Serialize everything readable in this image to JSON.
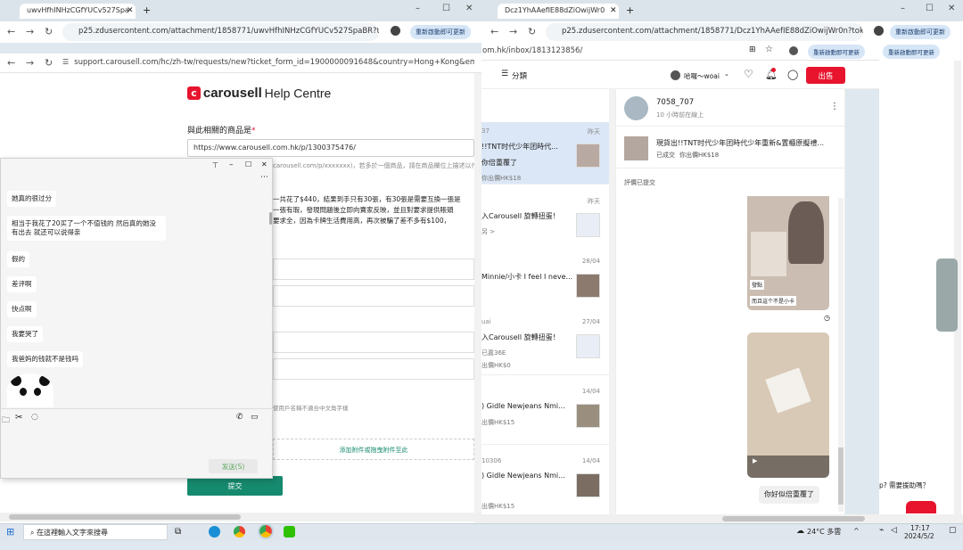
{
  "left_browser": {
    "tab_title": "uwvHfhINHzCGfYUCv527Spa",
    "url1": "p25.zdusercontent.com/attachment/1858771/uwvHfhINHzCGfYUCv527SpaBR?token...",
    "url2": "support.carousell.com/hc/zh-tw/requests/new?ticket_form_id=1900000091648&country=Hong+Kong&email=cixuan0",
    "update_pill": "重新啟動即可更新"
  },
  "help_page": {
    "logo_text": "carousell",
    "help_centre": "Help Centre",
    "item_label": "與此相關的商品是",
    "required_mark": "*",
    "item_url": "https://www.carousell.com.hk/p/1300375476/",
    "partial_hint": "carousell.com/p/xxxxxxx)，若多於一個商品，請在商品欄位上描述以作分辨",
    "desc_line1": "一共花了$440，結果到手只有30張，有30張是需要互換一張是",
    "desc_line2": "一張有瑕，發現問題後立即向賣家反映，並且對要求提供賬頭",
    "desc_line3": "要求全，因為卡牌生活費用高，再次被騙了差不多有$100，",
    "filename_hint": "使用戶名稱不適合中文角字樣",
    "attach_link": "添加附件或拖曳附件至此",
    "submit": "提交"
  },
  "chat_popup": {
    "messages": [
      "她真的很过分",
      "相当于我花了20买了一个不值钱的 然后真的她没有出去 就还可以说得亲",
      "假的",
      "差评啊",
      "快点啊",
      "我要哭了",
      "我爸妈的钱就不是钱吗"
    ],
    "send_button": "发送(S)"
  },
  "right_browser": {
    "tab_title": "Dcz1YhAAefIE88dZiOwijWr0",
    "url1": "p25.zdusercontent.com/attachment/1858771/Dcz1YhAAefIE88dZiOwijWr0n?token=...",
    "url2": "om.hk/inbox/1813123856/",
    "update_pill": "重新啟動即可更新",
    "category": "分類",
    "user_name": "哈囉～woai",
    "sell_button": "出售"
  },
  "conversations": [
    {
      "date": "昨天",
      "title": "!!TNT时代少年团時代...",
      "sub": "你倍重覆了",
      "sub2": "你出價HK$18"
    },
    {
      "date": "昨天",
      "title": "入Carousell 旋轉扭蛋！",
      "sub": "另 >",
      "sub2": ""
    },
    {
      "date": "28/04",
      "title": "Minnie/小卡 I feel I neve...",
      "sub": "",
      "sub2": ""
    },
    {
      "date": "27/04",
      "title": "入Carousell 旋轉扭蛋！",
      "sub": "已嘉36E",
      "sub2": "出價HK$0"
    },
    {
      "date": "14/04",
      "title": ") Gidle Newjeans Nmi...",
      "sub": "出價HK$15",
      "sub2": ""
    },
    {
      "date": "14/04",
      "title": ") Gidle Newjeans Nmi...",
      "sub": "出價HK$15",
      "sub2": ""
    }
  ],
  "chat_detail": {
    "seller": "7058_707",
    "status": "10 小時前在線上",
    "product_title": "現貨出!!TNT时代少年团時代少年重新&置櫃原擬禮...",
    "deal_status": "已成交",
    "your_offer": "你出價HK$18",
    "review_status": "評價已提交",
    "photo_tag1": "發點",
    "photo_tag2": "而且這个不是小卡",
    "last_msg": "你好似倍重覆了"
  },
  "right_side_fragment": {
    "pill": "重新啟動即可更新",
    "question": "p? 需要援助嗎？"
  },
  "taskbar": {
    "search_placeholder": "在這裡輸入文字來搜尋",
    "weather": "24°C 多雲",
    "time": "17:17",
    "date": "2024/5/2"
  },
  "colors": {
    "accent_red": "#e8142d",
    "teal": "#168a6e",
    "chat_bg": "#f5f5f5"
  }
}
